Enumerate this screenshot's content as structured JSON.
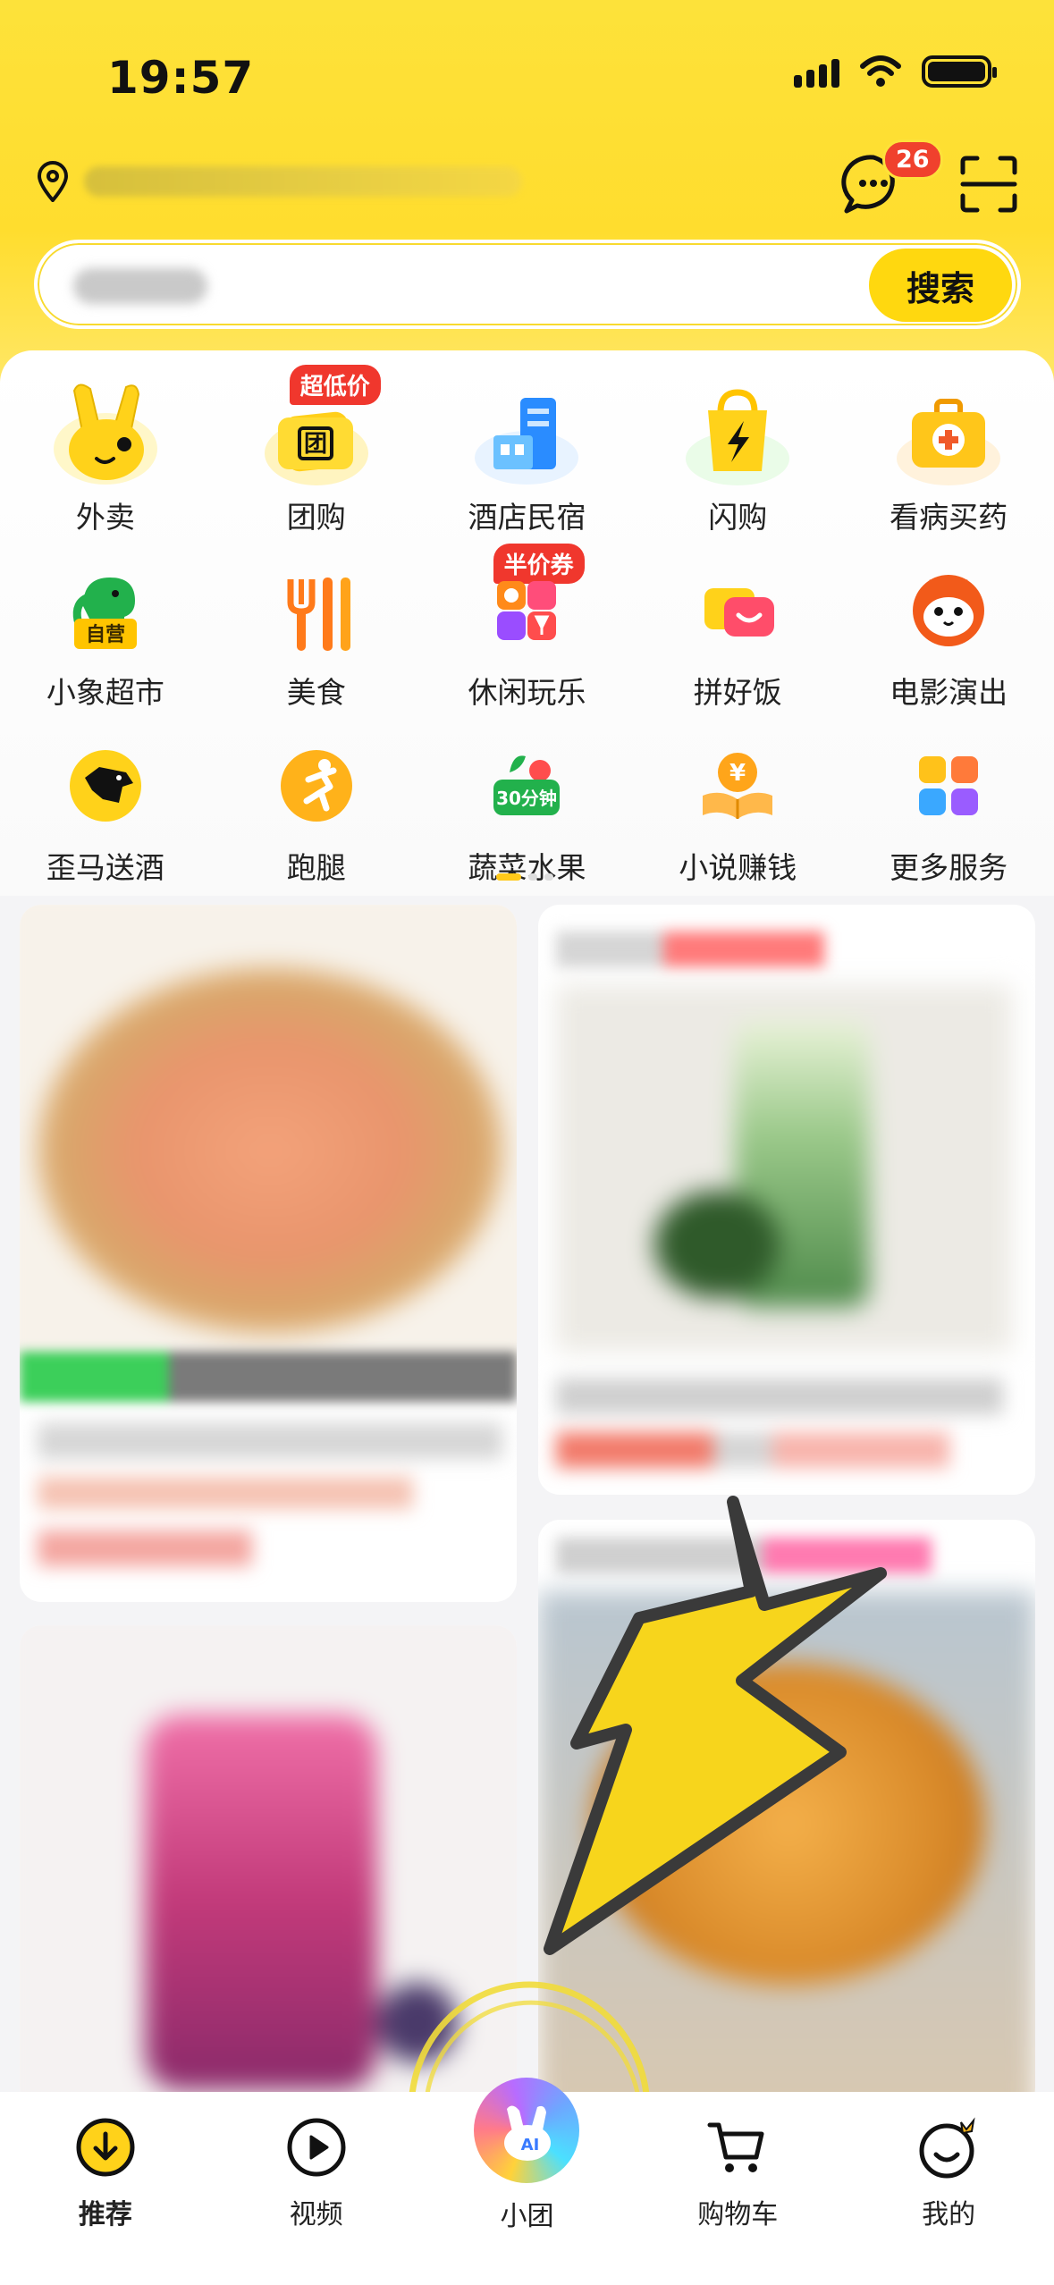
{
  "status_bar": {
    "time": "19:57"
  },
  "header": {
    "message_badge": "26",
    "icons": [
      "location-icon",
      "message-icon",
      "scan-icon"
    ]
  },
  "search": {
    "button_label": "搜索"
  },
  "categories": [
    {
      "label": "外卖",
      "icon": "takeout-rabbit-icon"
    },
    {
      "label": "团购",
      "icon": "group-buy-ticket-icon",
      "tag": "超低价"
    },
    {
      "label": "酒店民宿",
      "icon": "hotel-building-icon"
    },
    {
      "label": "闪购",
      "icon": "flash-bag-icon"
    },
    {
      "label": "看病买药",
      "icon": "medical-kit-icon"
    },
    {
      "label": "小象超市",
      "icon": "elephant-market-icon",
      "sub": "自营"
    },
    {
      "label": "美食",
      "icon": "fork-knife-icon"
    },
    {
      "label": "休闲玩乐",
      "icon": "leisure-icon",
      "tag": "半价券"
    },
    {
      "label": "拼好饭",
      "icon": "pin-fan-icon"
    },
    {
      "label": "电影演出",
      "icon": "cat-movie-icon"
    },
    {
      "label": "歪马送酒",
      "icon": "horse-wine-icon"
    },
    {
      "label": "跑腿",
      "icon": "runner-icon"
    },
    {
      "label": "蔬菜水果",
      "icon": "veg-fruit-icon",
      "sub": "30分钟"
    },
    {
      "label": "小说赚钱",
      "icon": "novel-coin-icon",
      "sub": "¥"
    },
    {
      "label": "更多服务",
      "icon": "more-grid-icon"
    }
  ],
  "tabbar": [
    {
      "label": "推荐",
      "icon": "recommend-icon",
      "active": true
    },
    {
      "label": "视频",
      "icon": "video-play-icon",
      "active": false
    },
    {
      "label": "小团",
      "icon": "ai-assistant-icon",
      "active": false
    },
    {
      "label": "购物车",
      "icon": "cart-icon",
      "active": false
    },
    {
      "label": "我的",
      "icon": "profile-icon",
      "active": false
    }
  ],
  "colors": {
    "brand": "#ffdd2e",
    "tag_red": "#f0372d",
    "annotation": "#f6d21a"
  }
}
